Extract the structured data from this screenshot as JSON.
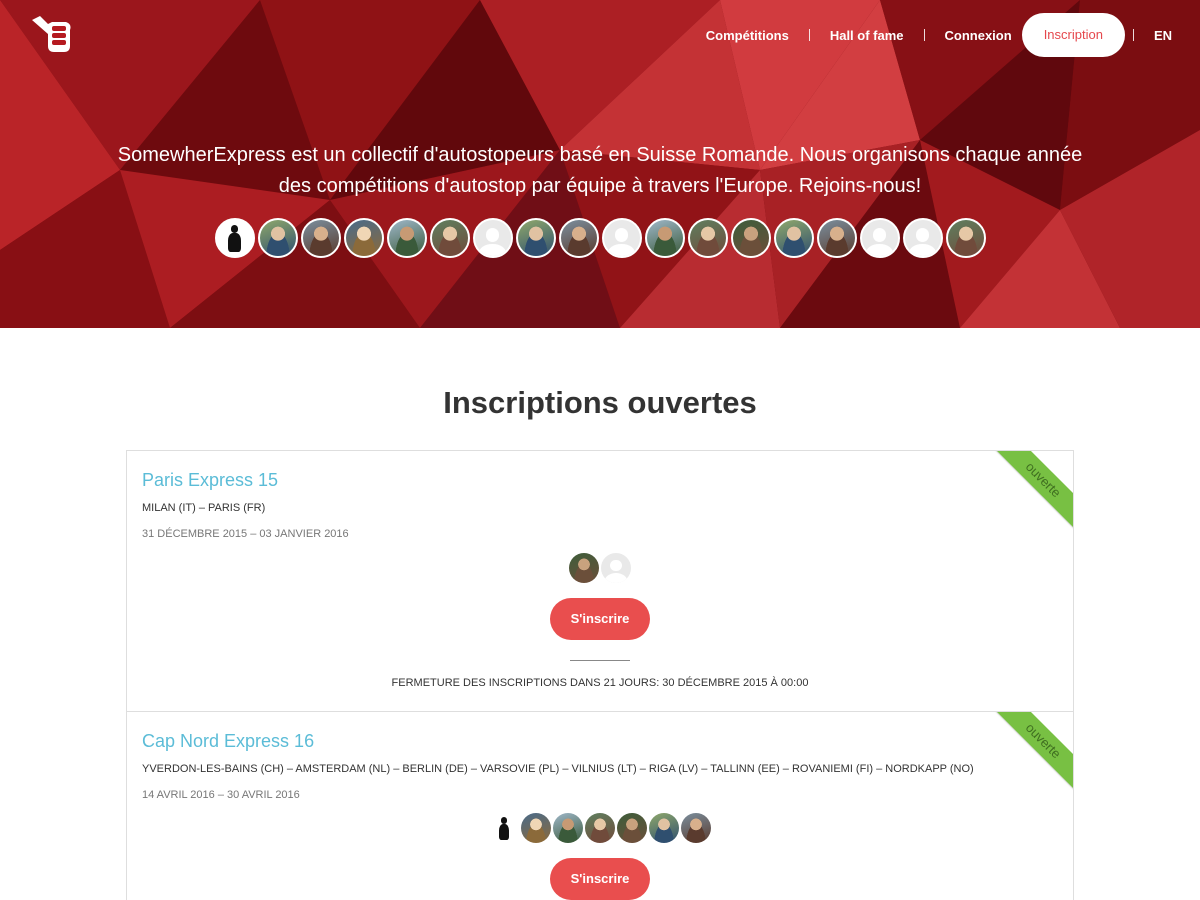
{
  "nav": {
    "competitions": "Compétitions",
    "hall_of_fame": "Hall of fame",
    "login": "Connexion",
    "signup": "Inscription",
    "language": "EN"
  },
  "hero": {
    "text": "SomewherExpress est un collectif d'autostopeurs basé en Suisse Romande. Nous organisons chaque année des compétitions d'autostop par équipe à travers l'Europe. Rejoins-nous!",
    "avatars": [
      "hiker",
      "photo",
      "photo",
      "photo",
      "photo",
      "photo",
      "blank",
      "photo",
      "photo",
      "blank",
      "photo",
      "photo",
      "photo",
      "photo",
      "photo",
      "blank",
      "blank",
      "photo"
    ]
  },
  "main": {
    "title": "Inscriptions ouvertes",
    "competitions": [
      {
        "title": "Paris Express 15",
        "route": "MILAN (IT) – PARIS (FR)",
        "dates": "31 DÉCEMBRE 2015 – 03 JANVIER 2016",
        "badge": "ouverte",
        "button": "S'inscrire",
        "deadline": "FERMETURE DES INSCRIPTIONS DANS 21 JOURS: 30 DÉCEMBRE 2015 À 00:00",
        "participants": [
          "photo",
          "blank"
        ]
      },
      {
        "title": "Cap Nord Express 16",
        "route": "YVERDON-LES-BAINS (CH) – AMSTERDAM (NL) – BERLIN (DE) – VARSOVIE (PL) – VILNIUS (LT) – RIGA (LV) – TALLINN (EE) – ROVANIEMI (FI) – NORDKAPP (NO)",
        "dates": "14 AVRIL 2016 – 30 AVRIL 2016",
        "badge": "ouverte",
        "button": "S'inscrire",
        "participants": [
          "hiker",
          "photo",
          "photo",
          "photo",
          "photo",
          "photo",
          "photo"
        ]
      }
    ]
  },
  "colors": {
    "accent": "#e94e4e",
    "link": "#5bbcd7",
    "ribbon": "#78c043",
    "hero_dark": "#8e1015"
  }
}
